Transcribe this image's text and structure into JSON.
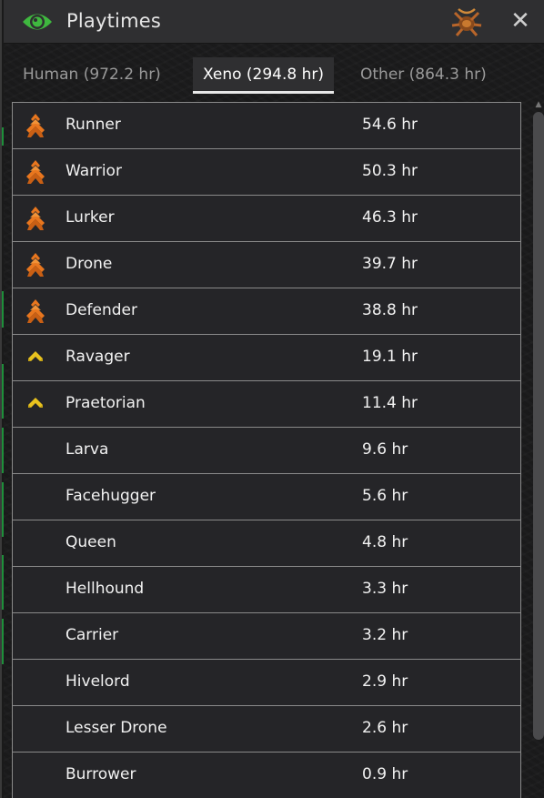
{
  "window": {
    "title": "Playtimes"
  },
  "tabs": [
    {
      "label": "Human (972.2 hr)",
      "active": false
    },
    {
      "label": "Xeno (294.8 hr)",
      "active": true
    },
    {
      "label": "Other (864.3 hr)",
      "active": false
    }
  ],
  "rows": [
    {
      "name": "Runner",
      "time": "54.6 hr",
      "icon": "orange-chevron-rank-icon"
    },
    {
      "name": "Warrior",
      "time": "50.3 hr",
      "icon": "orange-chevron-rank-icon"
    },
    {
      "name": "Lurker",
      "time": "46.3 hr",
      "icon": "orange-chevron-rank-icon"
    },
    {
      "name": "Drone",
      "time": "39.7 hr",
      "icon": "orange-chevron-rank-icon"
    },
    {
      "name": "Defender",
      "time": "38.8 hr",
      "icon": "orange-chevron-rank-icon"
    },
    {
      "name": "Ravager",
      "time": "19.1 hr",
      "icon": "yellow-chevron-rank-icon"
    },
    {
      "name": "Praetorian",
      "time": "11.4 hr",
      "icon": "yellow-chevron-rank-icon"
    },
    {
      "name": "Larva",
      "time": "9.6 hr",
      "icon": ""
    },
    {
      "name": "Facehugger",
      "time": "5.6 hr",
      "icon": ""
    },
    {
      "name": "Queen",
      "time": "4.8 hr",
      "icon": ""
    },
    {
      "name": "Hellhound",
      "time": "3.3 hr",
      "icon": ""
    },
    {
      "name": "Carrier",
      "time": "3.2 hr",
      "icon": ""
    },
    {
      "name": "Hivelord",
      "time": "2.9 hr",
      "icon": ""
    },
    {
      "name": "Lesser Drone",
      "time": "2.6 hr",
      "icon": ""
    },
    {
      "name": "Burrower",
      "time": "0.9 hr",
      "icon": ""
    }
  ],
  "colors": {
    "eye_green": "#3fb83f",
    "rank_orange": "#e8761e",
    "rank_yellow": "#e8c21e"
  }
}
